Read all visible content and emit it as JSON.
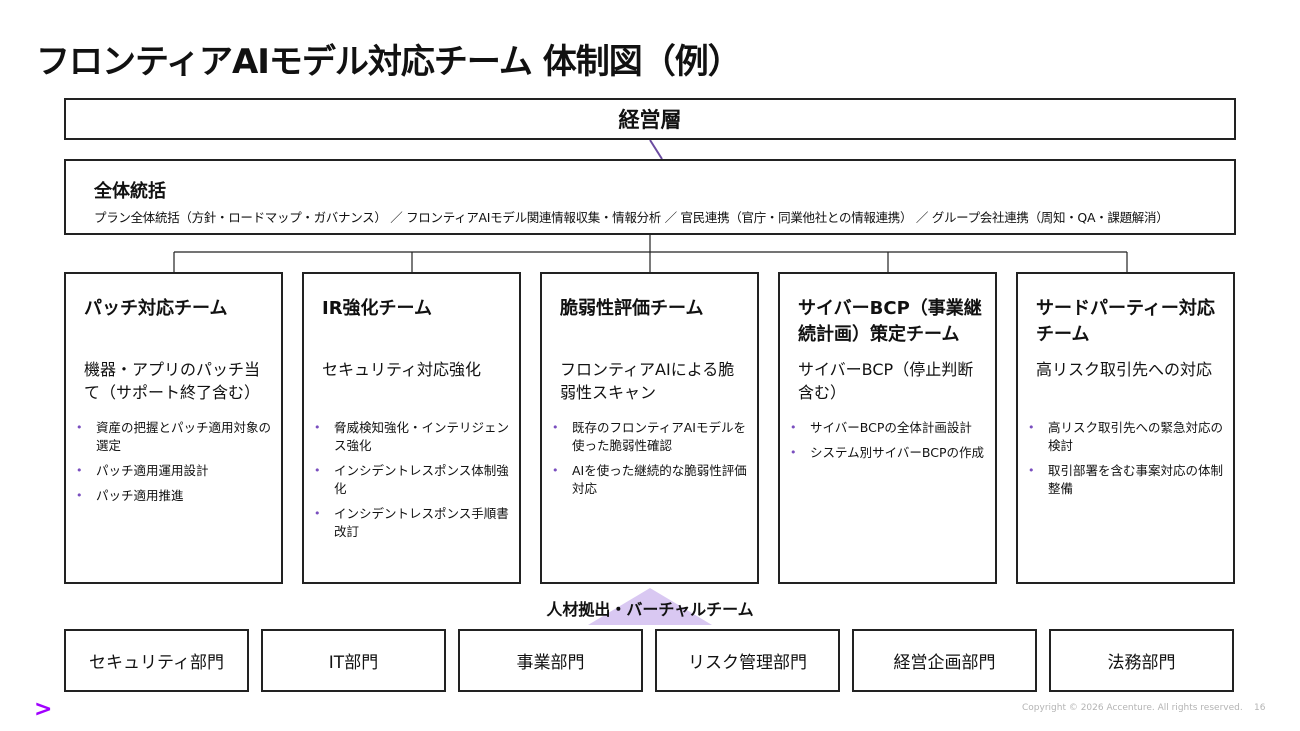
{
  "title": "フロンティアAIモデル対応チーム 体制図（例）",
  "executive": "経営層",
  "overall": {
    "title": "全体統括",
    "description": "プラン全体統括（方針・ロードマップ・ガバナンス） ／ フロンティアAIモデル関連情報収集・情報分析 ／ 官民連携（官庁・同業他社との情報連携） ／ グループ会社連携（周知・QA・課題解消）"
  },
  "teams": [
    {
      "title": "パッチ対応チーム",
      "subtitle": "機器・アプリのパッチ当て（サポート終了含む）",
      "bullets": [
        "資産の把握とパッチ適用対象の選定",
        "パッチ適用運用設計",
        "パッチ適用推進"
      ]
    },
    {
      "title": "IR強化チーム",
      "subtitle": "セキュリティ対応強化",
      "bullets": [
        "脅威検知強化・インテリジェンス強化",
        "インシデントレスポンス体制強化",
        "インシデントレスポンス手順書改訂"
      ]
    },
    {
      "title": "脆弱性評価チーム",
      "subtitle": "フロンティアAIによる脆弱性スキャン",
      "bullets": [
        "既存のフロンティアAIモデルを使った脆弱性確認",
        "AIを使った継続的な脆弱性評価対応"
      ]
    },
    {
      "title": "サイバーBCP（事業継続計画）策定チーム",
      "subtitle": "サイバーBCP（停止判断含む）",
      "bullets": [
        "サイバーBCPの全体計画設計",
        "システム別サイバーBCPの作成"
      ]
    },
    {
      "title": "サードパーティー対応チーム",
      "subtitle": "高リスク取引先への対応",
      "bullets": [
        "高リスク取引先への緊急対応の検討",
        "取引部署を含む事案対応の体制整備"
      ]
    }
  ],
  "virtual_team": "人材拠出・バーチャルチーム",
  "departments": [
    "セキュリティ部門",
    "IT部門",
    "事業部門",
    "リスク管理部門",
    "経営企画部門",
    "法務部門"
  ],
  "footer": {
    "logo": ">",
    "copyright": "Copyright © 2026 Accenture. All rights reserved.",
    "page": "16"
  },
  "colors": {
    "accent": "#a100ff",
    "triangle": "#d9c8f2",
    "connector": "#6b4ca0",
    "border": "#222222"
  }
}
